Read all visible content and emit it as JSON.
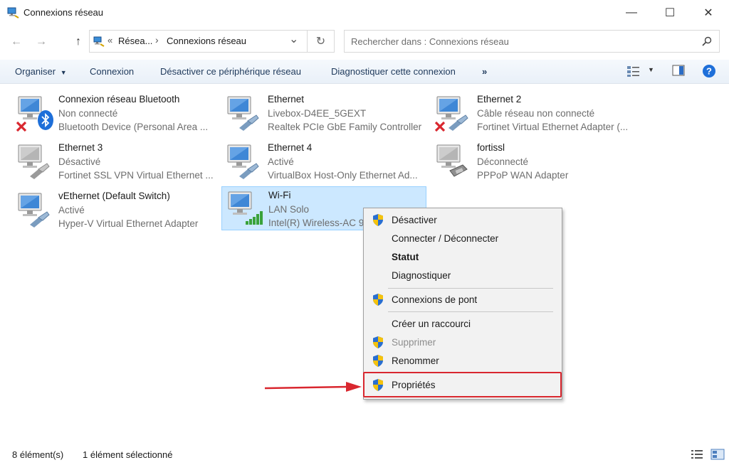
{
  "window": {
    "title": "Connexions réseau",
    "minimize_glyph": "—",
    "maximize_glyph": "☐",
    "close_glyph": "✕"
  },
  "nav": {
    "back_glyph": "←",
    "forward_glyph": "→",
    "up_glyph": "↑",
    "breadcrumb_prefix": "«",
    "breadcrumb_parent": "Résea...",
    "breadcrumb_sep": "›",
    "breadcrumb_current": "Connexions réseau",
    "dropdown_glyph": "⌄",
    "refresh_glyph": "↻"
  },
  "search": {
    "placeholder": "Rechercher dans : Connexions réseau"
  },
  "toolbar": {
    "organize": "Organiser",
    "connect": "Connexion",
    "disable": "Désactiver ce périphérique réseau",
    "diagnose": "Diagnostiquer cette connexion",
    "more": "»"
  },
  "connections": [
    {
      "name": "Connexion réseau Bluetooth",
      "status": "Non connecté",
      "device": "Bluetooth Device (Personal Area ...",
      "badge": "bluetooth",
      "error": true
    },
    {
      "name": "Ethernet",
      "status": "Livebox-D4EE_5GEXT",
      "device": "Realtek PCIe GbE Family Controller",
      "badge": "cable",
      "error": false
    },
    {
      "name": "Ethernet 2",
      "status": "Câble réseau non connecté",
      "device": "Fortinet Virtual Ethernet Adapter (...",
      "badge": "cable",
      "error": true
    },
    {
      "name": "Ethernet 3",
      "status": "Désactivé",
      "device": "Fortinet SSL VPN Virtual Ethernet ...",
      "badge": "cable",
      "error": false
    },
    {
      "name": "Ethernet 4",
      "status": "Activé",
      "device": "VirtualBox Host-Only Ethernet Ad...",
      "badge": "cable",
      "error": false
    },
    {
      "name": "fortissl",
      "status": "Déconnecté",
      "device": "PPPoP WAN Adapter",
      "badge": "modem",
      "error": false
    },
    {
      "name": "vEthernet (Default Switch)",
      "status": "Activé",
      "device": "Hyper-V Virtual Ethernet Adapter",
      "badge": "cable",
      "error": false
    },
    {
      "name": "Wi-Fi",
      "status": "LAN Solo",
      "device": "Intel(R) Wireless-AC 9",
      "badge": "wifi",
      "error": false
    }
  ],
  "context_menu": {
    "items": [
      {
        "label": "Désactiver"
      },
      {
        "label": "Connecter / Déconnecter"
      },
      {
        "label": "Statut"
      },
      {
        "label": "Diagnostiquer"
      },
      {
        "label": "Connexions de pont"
      },
      {
        "label": "Créer un raccourci"
      },
      {
        "label": "Supprimer"
      },
      {
        "label": "Renommer"
      },
      {
        "label": "Propriétés"
      }
    ]
  },
  "statusbar": {
    "count": "8 élément(s)",
    "selected": "1 élément sélectionné"
  },
  "colors": {
    "accent": "#0078d7",
    "selection": "#cce8ff",
    "highlight_red": "#d9272f",
    "help_blue": "#1e6fd9"
  }
}
